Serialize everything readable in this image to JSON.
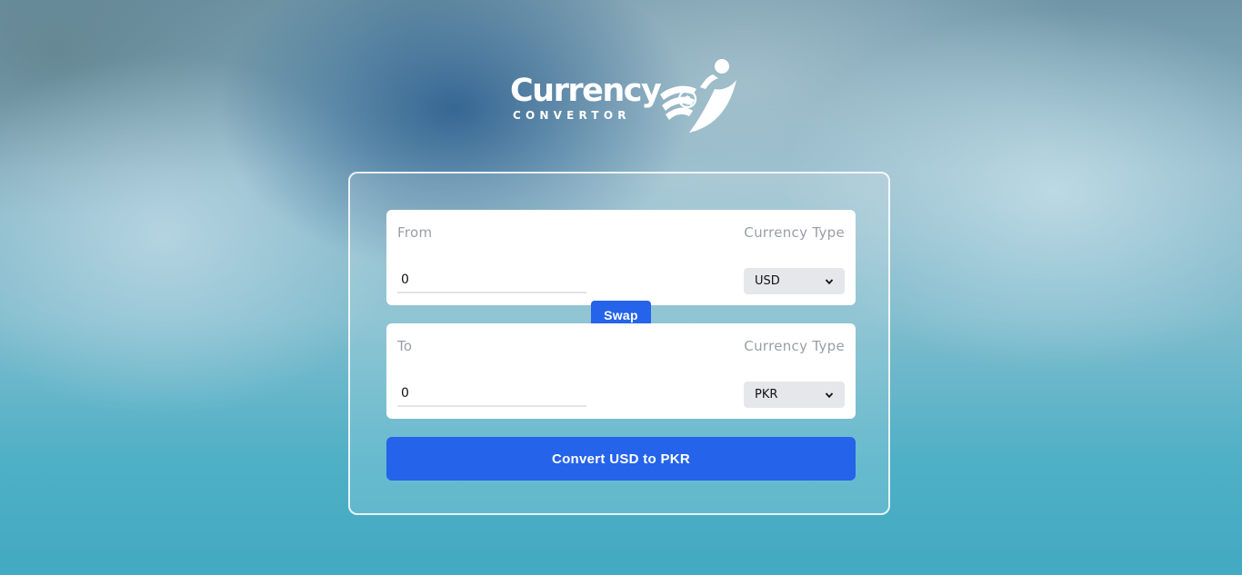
{
  "logo": {
    "title": "Currency",
    "subtitle": "CONVERTOR"
  },
  "from_panel": {
    "label": "From",
    "type_label": "Currency Type",
    "amount": "0",
    "currency": "USD"
  },
  "to_panel": {
    "label": "To",
    "type_label": "Currency Type",
    "amount": "0",
    "currency": "PKR"
  },
  "swap_label": "Swap",
  "convert_label": "Convert USD to PKR",
  "colors": {
    "accent": "#2563eb",
    "panel": "#ffffff",
    "select_bg": "#e5e7eb",
    "muted_text": "#9a9ea5"
  }
}
